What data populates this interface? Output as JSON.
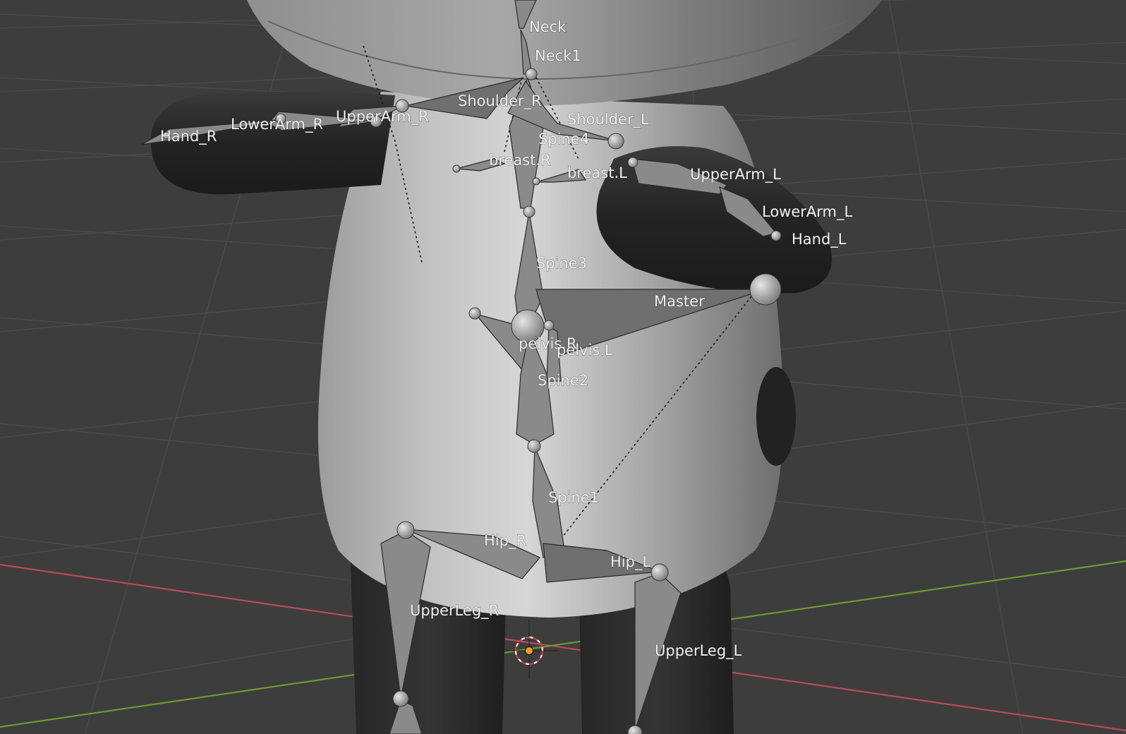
{
  "app": "Blender 3D Viewport",
  "viewport": {
    "mode": "pose",
    "grid_color": "#4a4a4a",
    "background": "#3d3d3d",
    "x_axis_color": "#b84a5a",
    "y_axis_color": "#6f9a2e"
  },
  "bones": {
    "neck": "Neck",
    "neck1": "Neck1",
    "shoulder_r": "Shoulder_R",
    "shoulder_l": "Shoulder_L",
    "upperarm_r": "UpperArm_R",
    "lowerarm_r": "LowerArm_R",
    "hand_r": "Hand_R",
    "spine4": "Spine4",
    "breast_r": "breast.R",
    "breast_l": "breast.L",
    "upperarm_l": "UpperArm_L",
    "lowerarm_l": "LowerArm_L",
    "hand_l": "Hand_L",
    "spine3": "Spine3",
    "master": "Master",
    "pelvis_r": "pelvis.R",
    "pelvis_l": "pelvis.L",
    "spine2": "Spine2",
    "spine1": "Spine1",
    "hip_r": "Hip_R",
    "hip_l": "Hip_L",
    "upperleg_r": "UpperLeg_R",
    "upperleg_l": "UpperLeg_L"
  },
  "icons": {
    "cursor": "3d-cursor-icon",
    "origin": "object-origin-icon"
  },
  "colors": {
    "origin": "#f0a020",
    "cursor_ring": "#d83a3a"
  }
}
